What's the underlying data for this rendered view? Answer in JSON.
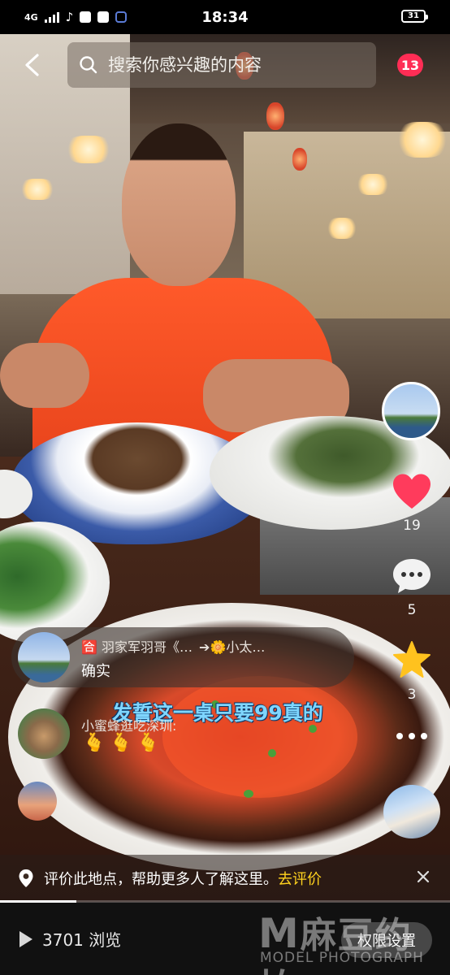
{
  "status_bar": {
    "network": "4G",
    "time": "18:34",
    "battery": "31"
  },
  "search": {
    "placeholder": "搜索你感兴趣的内容",
    "notification_count": "13"
  },
  "actions": {
    "like_count": "19",
    "comment_count": "5",
    "favorite_count": "3"
  },
  "comments": [
    {
      "name": "羽家军羽哥《…",
      "reply_to": "➔🌼小太…",
      "text": "确实"
    },
    {
      "name": "小蜜蜂逛吃深圳:",
      "text": "🫰🫰🫰"
    }
  ],
  "video": {
    "caption": "发誓这一桌只要99真的",
    "progress": 0.17
  },
  "location_bar": {
    "text": "评价此地点，帮助更多人了解这里。",
    "link": "去评价"
  },
  "footer": {
    "views": "3701 浏览",
    "permission_button": "权限设置"
  },
  "watermark": {
    "main": "麻豆约拍",
    "sub": "MODEL PHOTOGRAPH"
  },
  "colors": {
    "badge": "#ff2d55",
    "like": "#ff3b5c",
    "favorite": "#ffc21e",
    "link": "#ffd21e",
    "caption": "#7fd6ff"
  }
}
